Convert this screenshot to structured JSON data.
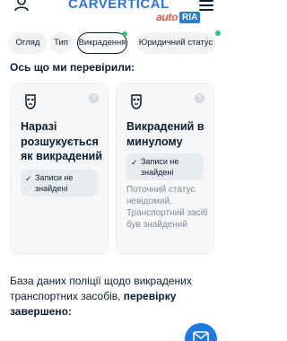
{
  "header": {
    "logo_text": "CARVERTICAL",
    "partner_logo_auto": "auto",
    "partner_logo_ria": "RIA",
    "icons": [
      "user-icon",
      "menu-icon"
    ],
    "brand_color": "#2d74d8"
  },
  "tabs": [
    {
      "label": "Огляд",
      "active": false
    },
    {
      "label": "Тип",
      "active": false
    },
    {
      "label": "Викрадення",
      "active": true
    },
    {
      "label": "Юридичний статус",
      "active": false
    }
  ],
  "section": {
    "title": "Ось що ми перевірили:"
  },
  "cards": [
    {
      "title": "Наразі розшукується як викрадений",
      "badge": "Записи не знайдені",
      "description": ""
    },
    {
      "title": "Викрадений в минулому",
      "badge": "Записи не знайдені",
      "description": "Поточний статус невідомий. Транспортний засіб був знайдений"
    }
  ],
  "summary": {
    "text": "База даних поліції щодо викрадених транспортних засобів,",
    "bold": "перевірку завершено:"
  },
  "chat_button": {
    "icon": "mail-icon",
    "color": "#1e7ae0"
  }
}
